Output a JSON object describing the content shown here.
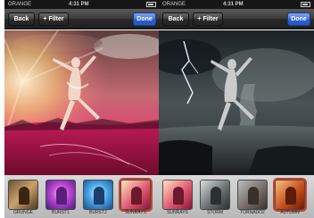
{
  "status_bar": {
    "carrier": "ORANGE",
    "time": "4:31 PM"
  },
  "screens": [
    {
      "nav": {
        "back_label": "Back",
        "filter_label": "+ Filter",
        "done_label": "Done"
      },
      "filters": [
        {
          "label": "GRUNGE"
        },
        {
          "label": "BURST1"
        },
        {
          "label": "BURST2"
        },
        {
          "label": "SUNRAYS"
        }
      ]
    },
    {
      "nav": {
        "back_label": "Back",
        "filter_label": "+ Filter",
        "done_label": "Done"
      },
      "filters": [
        {
          "label": "SUNRAYS"
        },
        {
          "label": "STORM"
        },
        {
          "label": "TORNADO2"
        },
        {
          "label": "AUTUMN"
        }
      ]
    }
  ],
  "colors": {
    "done_button": "#3f72dd",
    "selected_thumb": "#c8442b",
    "nav_bar": "#2a2a2a"
  }
}
